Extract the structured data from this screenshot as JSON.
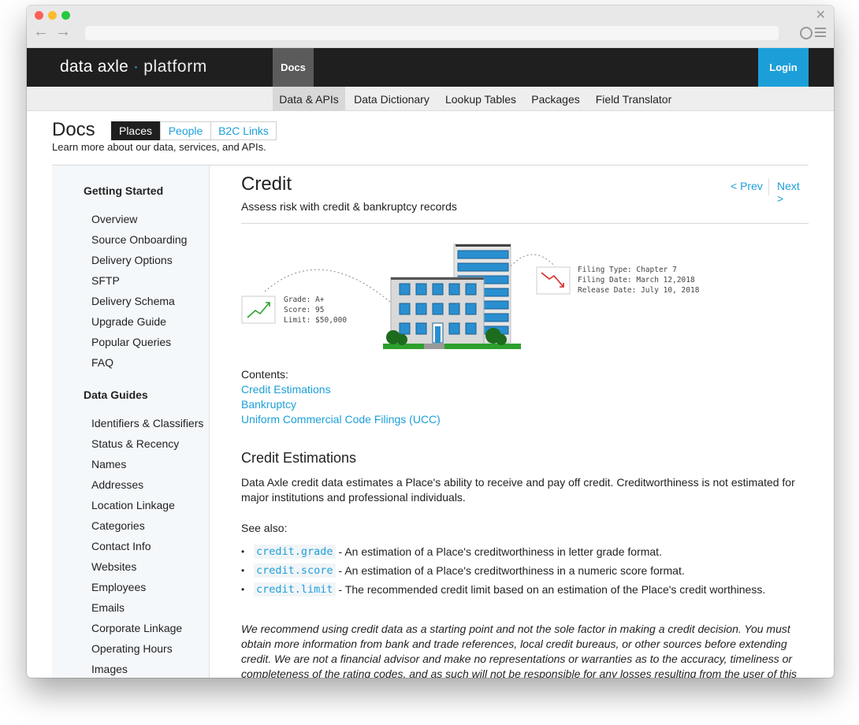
{
  "browser": {
    "dots": [
      "close",
      "minimize",
      "zoom"
    ],
    "close_glyph": "✕",
    "back_glyph": "←",
    "forward_glyph": "→"
  },
  "topbar": {
    "logo_main": "data axle",
    "logo_sep": "·",
    "logo_sub": "platform",
    "docs_tab": "Docs",
    "login": "Login"
  },
  "subnav": [
    "Data & APIs",
    "Data Dictionary",
    "Lookup Tables",
    "Packages",
    "Field Translator"
  ],
  "header": {
    "title": "Docs",
    "segments": [
      "Places",
      "People",
      "B2C Links"
    ],
    "subtitle": "Learn more about our data, services, and APIs."
  },
  "sidebar": {
    "getting_started": "Getting Started",
    "getting_started_items": [
      "Overview",
      "Source Onboarding",
      "Delivery Options",
      "SFTP",
      "Delivery Schema",
      "Upgrade Guide",
      "Popular Queries",
      "FAQ"
    ],
    "data_guides": "Data Guides",
    "data_guides_items": [
      "Identifiers & Classifiers",
      "Status & Recency",
      "Names",
      "Addresses",
      "Location Linkage",
      "Categories",
      "Contact Info",
      "Websites",
      "Employees",
      "Emails",
      "Corporate Linkage",
      "Operating Hours",
      "Images"
    ]
  },
  "content": {
    "title": "Credit",
    "tagline": "Assess risk with credit & bankruptcy records",
    "prev": "< Prev",
    "next": "Next >",
    "illustration": {
      "left_card": [
        "Grade: A+",
        "Score: 95",
        "Limit: $50,000"
      ],
      "right_card": [
        "Filing Type: Chapter 7",
        "Filing Date: March 12,2018",
        "Release Date: July 10, 2018"
      ]
    },
    "contents_label": "Contents:",
    "toc": [
      "Credit Estimations",
      "Bankruptcy",
      "Uniform Commercial Code Filings (UCC)"
    ],
    "section_title": "Credit Estimations",
    "intro": "Data Axle credit data estimates a Place's ability to receive and pay off credit. Creditworthiness is not estimated for major institutions and professional individuals.",
    "see_also": "See also:",
    "bullets": [
      {
        "code": "credit.grade",
        "text": "- An estimation of a Place's creditworthiness in letter grade format."
      },
      {
        "code": "credit.score",
        "text": "- An estimation of a Place's creditworthiness in a numeric score format."
      },
      {
        "code": "credit.limit",
        "text": "- The recommended credit limit based on an estimation of the Place's credit worthiness."
      }
    ],
    "disclaimer": "We recommend using credit data as a starting point and not the sole factor in making a credit decision. You must obtain more information from bank and trade references, local credit bureaus, or other sources before extending credit. We are not a financial advisor and make no representations or warranties as to the accuracy, timeliness or completeness of the rating codes, and as such will not be responsible for any losses resulting from the user of this"
  },
  "colors": {
    "accent": "#1c9fd9",
    "topbar": "#1f1f1f",
    "docs_tab": "#5b5b5b"
  }
}
